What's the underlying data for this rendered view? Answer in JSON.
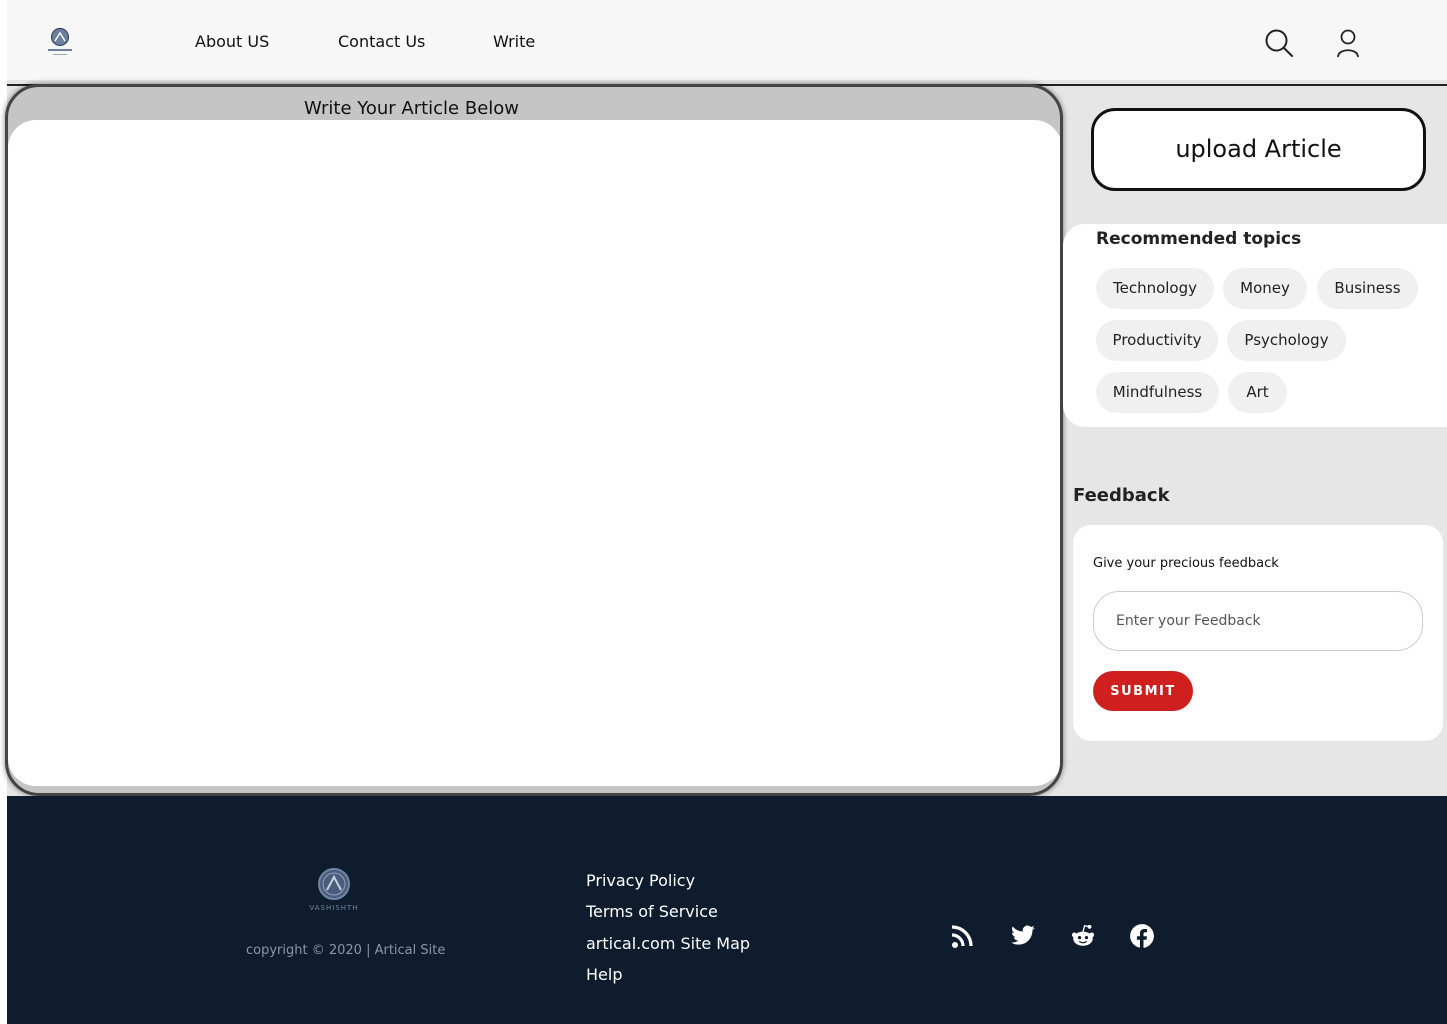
{
  "header": {
    "nav": [
      {
        "label": "About US"
      },
      {
        "label": "Contact Us"
      },
      {
        "label": "Write"
      }
    ],
    "logo_alt": "VASHISHTH"
  },
  "editor": {
    "title": "Write Your Article Below",
    "content": ""
  },
  "sidebar": {
    "upload_label": "upload Article",
    "topics_title": "Recommended topics",
    "topics": [
      "Technology",
      "Money",
      "Business",
      "Productivity",
      "Psychology",
      "Mindfulness",
      "Art"
    ],
    "feedback": {
      "title": "Feedback",
      "label": "Give your precious feedback",
      "placeholder": "Enter your Feedback",
      "submit_label": "SUBMIT"
    }
  },
  "footer": {
    "logo_text": "VASHISHTH",
    "copyright": "copyright  ©  2020 | Artical Site",
    "links": [
      "Privacy Policy",
      "Terms of Service",
      "artical.com Site Map",
      "Help"
    ],
    "social": [
      "rss-icon",
      "twitter-icon",
      "reddit-icon",
      "facebook-icon"
    ]
  },
  "colors": {
    "footer_bg": "#0f1c2e",
    "submit_red": "#cf1f1f",
    "main_bg": "#e6e6e6"
  }
}
